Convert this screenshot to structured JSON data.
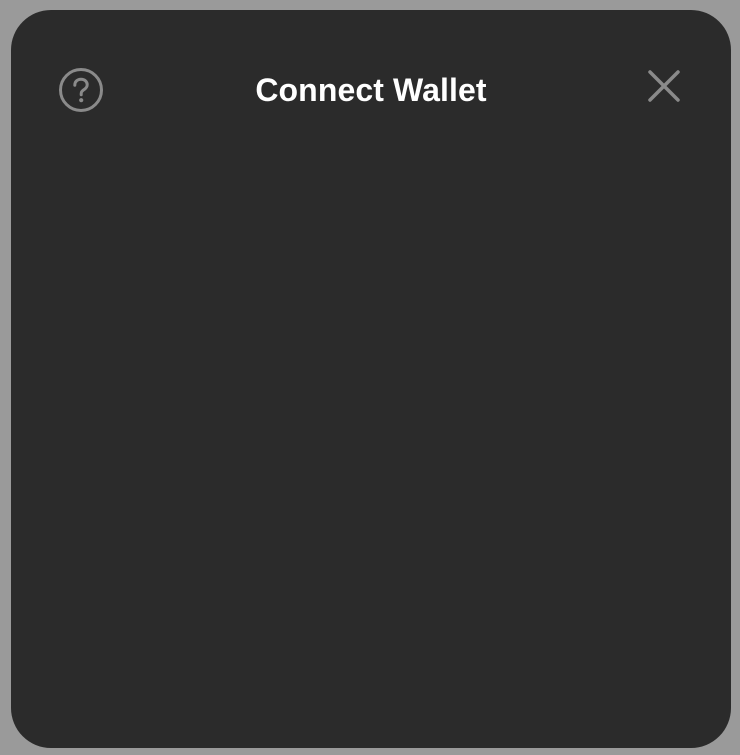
{
  "modal": {
    "title": "Connect Wallet",
    "help_icon": "question-circle-icon",
    "close_icon": "close-icon"
  },
  "colors": {
    "backdrop": "#9a9a9a",
    "modal_background": "#2b2b2b",
    "title_text": "#ffffff",
    "icon": "#8a8a8a"
  }
}
